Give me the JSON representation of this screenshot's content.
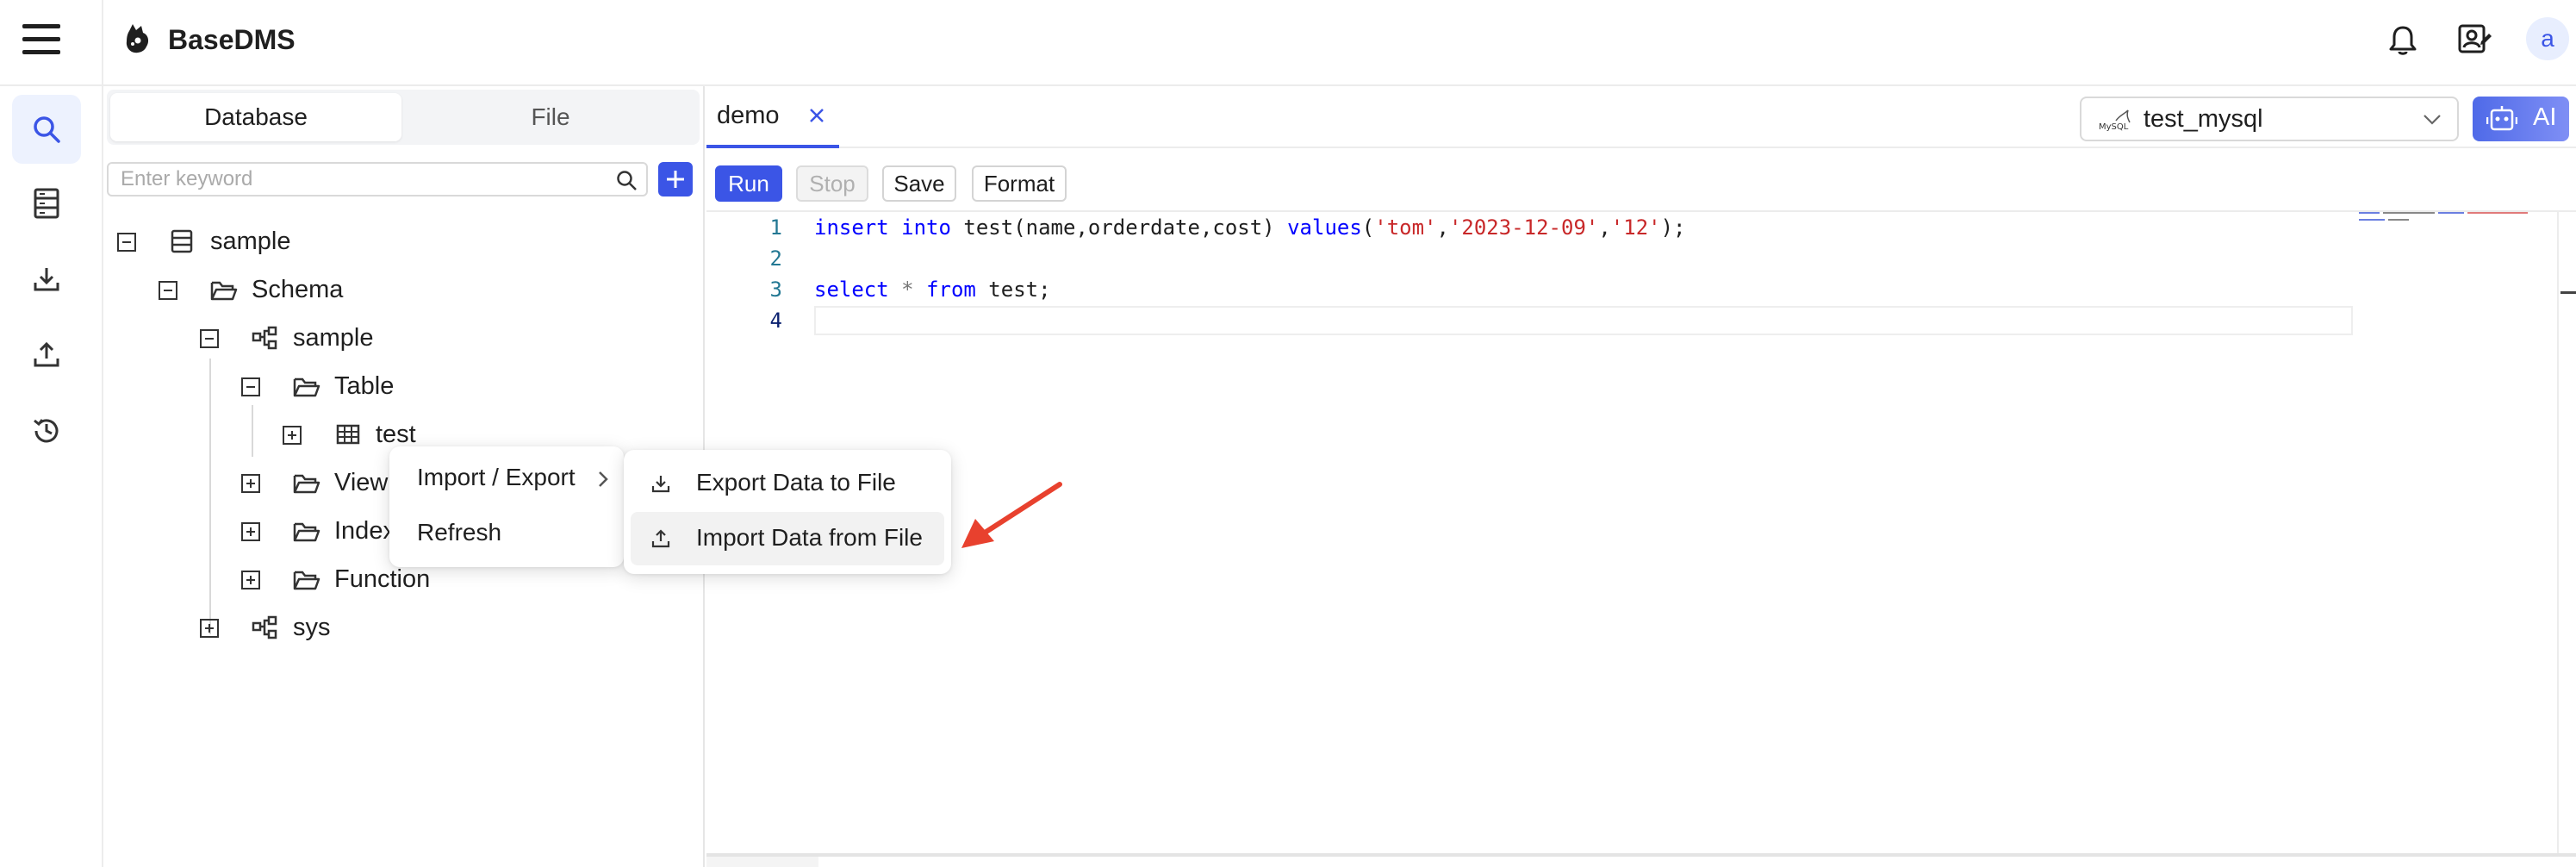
{
  "app": {
    "title": "BaseDMS"
  },
  "header": {
    "menu_icon": "hamburger-menu-icon",
    "logo_icon": "basedms-logo-icon",
    "actions": [
      {
        "name": "notifications",
        "icon": "bell-icon"
      },
      {
        "name": "user-settings",
        "icon": "user-edit-icon"
      }
    ],
    "avatar_letter": "a"
  },
  "rail": {
    "items": [
      {
        "name": "search",
        "icon": "search-icon",
        "active": true
      },
      {
        "name": "database",
        "icon": "database-icon",
        "active": false
      },
      {
        "name": "download",
        "icon": "download-icon",
        "active": false
      },
      {
        "name": "upload",
        "icon": "upload-icon",
        "active": false
      },
      {
        "name": "history",
        "icon": "history-icon",
        "active": false
      }
    ]
  },
  "sidepanel": {
    "tabs": [
      {
        "label": "Database",
        "active": true
      },
      {
        "label": "File",
        "active": false
      }
    ],
    "search": {
      "placeholder": "Enter keyword",
      "value": ""
    },
    "add_icon": "plus-icon",
    "tree": [
      {
        "label": "sample",
        "type": "database",
        "expanded": true
      },
      {
        "label": "Schema",
        "type": "folder",
        "expanded": true
      },
      {
        "label": "sample",
        "type": "schema",
        "expanded": true
      },
      {
        "label": "Table",
        "type": "folder",
        "expanded": true
      },
      {
        "label": "test",
        "type": "table",
        "expanded": false
      },
      {
        "label": "View",
        "type": "folder",
        "expanded": false
      },
      {
        "label": "Index",
        "type": "folder",
        "expanded": false
      },
      {
        "label": "Function",
        "type": "folder",
        "expanded": false
      },
      {
        "label": "sys",
        "type": "schema",
        "expanded": false
      }
    ]
  },
  "context_menu": {
    "items": [
      {
        "label": "Import / Export",
        "has_submenu": true
      },
      {
        "label": "Refresh",
        "has_submenu": false
      }
    ],
    "submenu": [
      {
        "label": "Export Data to File",
        "icon": "download-icon",
        "highlighted": false
      },
      {
        "label": "Import Data from File",
        "icon": "upload-icon",
        "highlighted": true
      }
    ]
  },
  "editor": {
    "tabs": [
      {
        "label": "demo",
        "active": true
      }
    ],
    "connection": {
      "label": "test_mysql",
      "icon": "mysql-icon"
    },
    "ai_label": "AI",
    "toolbar": {
      "run": "Run",
      "stop": "Stop",
      "save": "Save",
      "format": "Format"
    },
    "lines": [
      {
        "no": "1",
        "code": "insert into test(name,orderdate,cost) values('tom','2023-12-09','12');"
      },
      {
        "no": "2",
        "code": ""
      },
      {
        "no": "3",
        "code": "select * from test;"
      },
      {
        "no": "4",
        "code": ""
      }
    ]
  },
  "annotation": {
    "type": "arrow",
    "color": "#e8412e"
  },
  "colors": {
    "accent": "#3b55e6",
    "string": "#c82829",
    "keyword": "#0000ff",
    "line_number": "#237893"
  }
}
